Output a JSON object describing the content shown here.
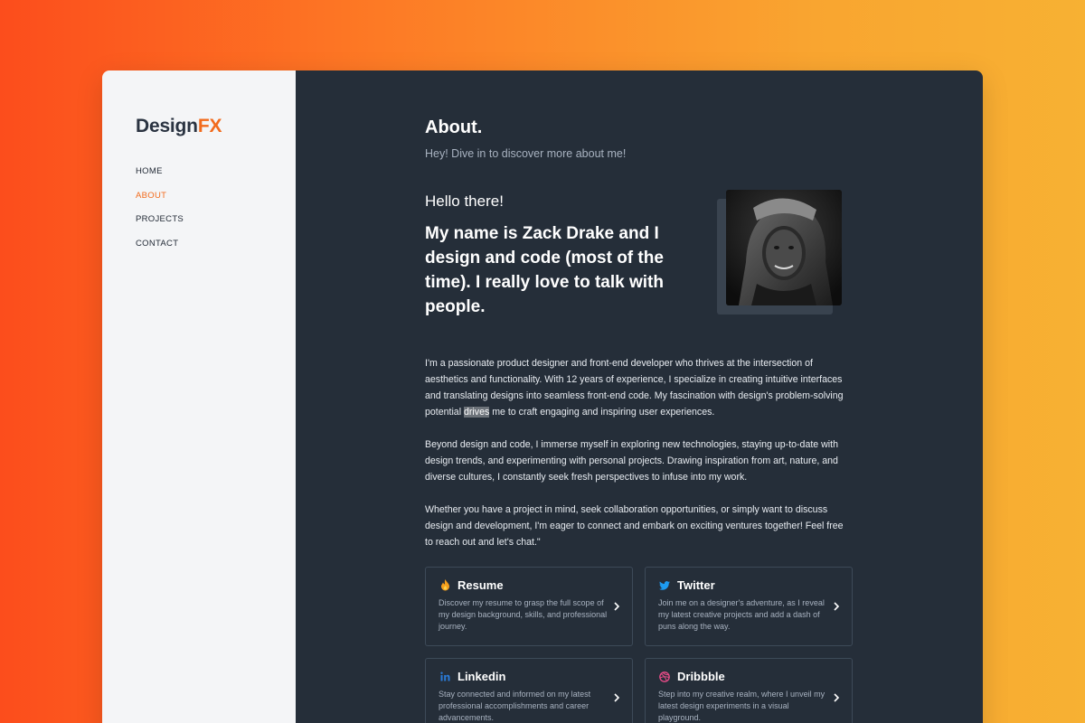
{
  "brand": {
    "name_main": "Design",
    "name_accent": "FX",
    "accent_color": "#f26b1d"
  },
  "nav": {
    "items": [
      {
        "label": "HOME",
        "active": false
      },
      {
        "label": "ABOUT",
        "active": true
      },
      {
        "label": "PROJECTS",
        "active": false
      },
      {
        "label": "CONTACT",
        "active": false
      }
    ]
  },
  "page": {
    "title": "About.",
    "subtitle": "Hey! Dive in to discover more about me!"
  },
  "hero": {
    "greeting": "Hello there!",
    "headline": "My name is Zack Drake and I design and code (most of the time). I really love to talk with people."
  },
  "bio": {
    "p1_before": "I'm a passionate product designer and front-end developer who thrives at the intersection of aesthetics and functionality. With 12 years of experience, I specialize in creating intuitive interfaces and translating designs into seamless front-end code. My fascination with design's problem-solving potential ",
    "p1_highlight": "drives",
    "p1_after": " me to craft engaging and inspiring user experiences.",
    "p2": "Beyond design and code, I immerse myself in exploring new technologies, staying up-to-date with design trends, and experimenting with personal projects. Drawing inspiration from art, nature, and diverse cultures, I constantly seek fresh perspectives to infuse into my work.",
    "p3": "Whether you have a project in mind, seek collaboration opportunities, or simply want to discuss design and development, I'm eager to connect and embark on exciting ventures together! Feel free to reach out and let's chat.\""
  },
  "cards": [
    {
      "title": "Resume",
      "icon": "flame-icon",
      "icon_color": "#f7a01c",
      "desc": "Discover my resume to grasp the full scope of my design background, skills, and professional journey."
    },
    {
      "title": "Twitter",
      "icon": "twitter-bird-icon",
      "icon_color": "#1d9bf0",
      "desc": "Join me on a designer's adventure, as I reveal my latest creative projects and add a dash of puns along the way."
    },
    {
      "title": "Linkedin",
      "icon": "linkedin-icon",
      "icon_color": "#2a7ad6",
      "desc": "Stay connected and informed on my latest professional accomplishments and career advancements."
    },
    {
      "title": "Dribbble",
      "icon": "dribbble-ball-icon",
      "icon_color": "#ea4c89",
      "desc": "Step into my creative realm, where I unveil my latest design experiments in a visual playground."
    }
  ]
}
